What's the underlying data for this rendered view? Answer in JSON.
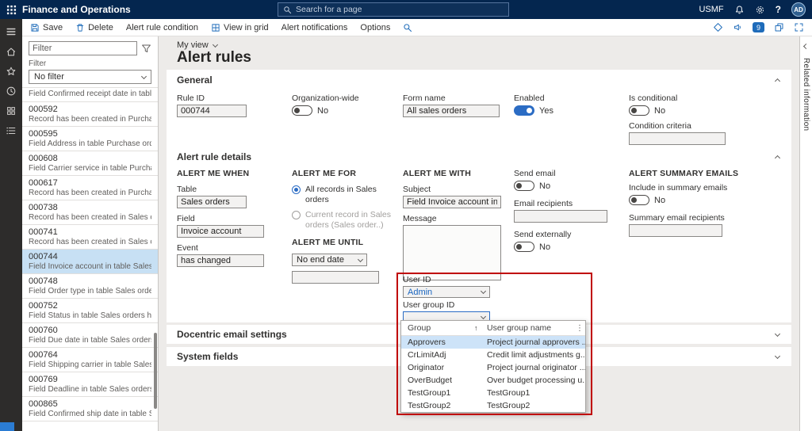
{
  "colors": {
    "topbar_bg": "#04264f",
    "rail_bg": "#2d2c2b",
    "accent_blue": "#1f6cba",
    "toggle_on": "#2b6cc4",
    "selected_row": "#c7e0f4",
    "annotation_red": "#c00000",
    "input_bg": "#f3f2f1"
  },
  "topbar": {
    "app_title": "Finance and Operations",
    "search_placeholder": "Search for a page",
    "company": "USMF",
    "help": "?",
    "avatar_initials": "AD"
  },
  "actionbar": {
    "save": "Save",
    "delete": "Delete",
    "alert_rule_condition": "Alert rule condition",
    "view_in_grid": "View in grid",
    "alert_notifications": "Alert notifications",
    "options": "Options",
    "chat_count": "9"
  },
  "list": {
    "filter_placeholder": "Filter",
    "filter_label": "Filter",
    "filter_value": "No filter",
    "top_partial": "Field Confirmed receipt date in tabl...",
    "items": [
      {
        "id": "000592",
        "desc": "Record has been created in Purchas..."
      },
      {
        "id": "000595",
        "desc": "Field Address in table Purchase ord..."
      },
      {
        "id": "000608",
        "desc": "Field Carrier service in table Purchas..."
      },
      {
        "id": "000617",
        "desc": "Record has been created in Purchas..."
      },
      {
        "id": "000738",
        "desc": "Record has been created in Sales or..."
      },
      {
        "id": "000741",
        "desc": "Record has been created in Sales or..."
      },
      {
        "id": "000744",
        "desc": "Field Invoice account in table Sales ..."
      },
      {
        "id": "000748",
        "desc": "Field Order type in table Sales order..."
      },
      {
        "id": "000752",
        "desc": "Field Status in table Sales orders has..."
      },
      {
        "id": "000760",
        "desc": "Field Due date in table Sales orders ..."
      },
      {
        "id": "000764",
        "desc": "Field Shipping carrier in table Sales ..."
      },
      {
        "id": "000769",
        "desc": "Field Deadline in table Sales orders ..."
      },
      {
        "id": "000865",
        "desc": "Field Confirmed ship date in table S..."
      }
    ]
  },
  "page": {
    "view_label": "My view",
    "title": "Alert rules"
  },
  "general": {
    "title": "General",
    "rule_id_label": "Rule ID",
    "rule_id_value": "000744",
    "org_label": "Organization-wide",
    "org_value": "No",
    "form_label": "Form name",
    "form_value": "All sales orders",
    "enabled_label": "Enabled",
    "enabled_value": "Yes",
    "conditional_label": "Is conditional",
    "conditional_value": "No",
    "criteria_label": "Condition criteria"
  },
  "details": {
    "title": "Alert rule details",
    "when": {
      "header": "ALERT ME WHEN",
      "table_label": "Table",
      "table_value": "Sales orders",
      "field_label": "Field",
      "field_value": "Invoice account",
      "event_label": "Event",
      "event_value": "has changed"
    },
    "scope": {
      "header": "ALERT ME FOR",
      "all_records": "All records in Sales orders",
      "current_record": "Current record in Sales orders (Sales order..)",
      "until_header": "ALERT ME UNTIL",
      "until_value": "No end date"
    },
    "payload": {
      "header": "ALERT ME WITH",
      "subject_label": "Subject",
      "subject_value": "Field Invoice account in table...",
      "message_label": "Message"
    },
    "email": {
      "send_label": "Send email",
      "send_value": "No",
      "recipients_label": "Email recipients",
      "external_label": "Send externally",
      "external_value": "No"
    },
    "summary": {
      "header": "ALERT SUMMARY EMAILS",
      "include_label": "Include in summary emails",
      "include_value": "No",
      "recipients_label": "Summary email recipients"
    },
    "user": {
      "user_id_label": "User ID",
      "user_id_value": "Admin",
      "group_label": "User group ID"
    }
  },
  "popup": {
    "col_group": "Group",
    "sort_icon": "↑",
    "col_name": "User group name",
    "menu_icon": "⋮",
    "rows": [
      {
        "group": "Approvers",
        "name": "Project journal approvers ..."
      },
      {
        "group": "CrLimitAdj",
        "name": "Credit limit adjustments g..."
      },
      {
        "group": "Originator",
        "name": "Project journal originator ..."
      },
      {
        "group": "OverBudget",
        "name": "Over budget processing u..."
      },
      {
        "group": "TestGroup1",
        "name": "TestGroup1"
      },
      {
        "group": "TestGroup2",
        "name": "TestGroup2"
      }
    ]
  },
  "collapsed_sections": {
    "docentric": "Docentric email settings",
    "system": "System fields"
  },
  "related_panel": {
    "label": "Related information"
  }
}
